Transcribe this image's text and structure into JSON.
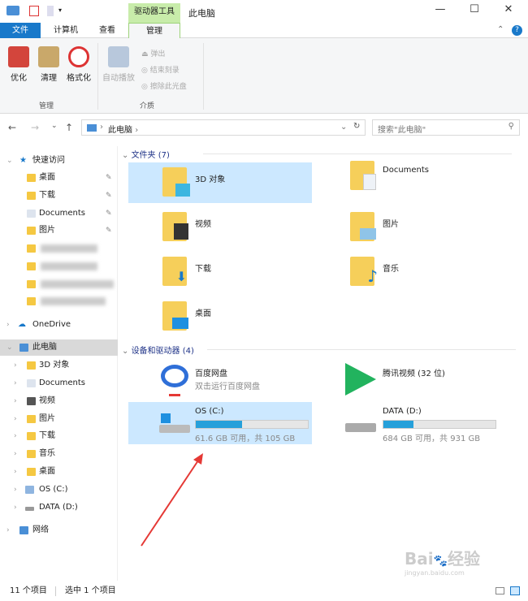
{
  "window": {
    "title": "此电脑",
    "context_tab_header": "驱动器工具",
    "controls": [
      "minimize",
      "maximize",
      "close"
    ]
  },
  "tabs": [
    {
      "label": "文件"
    },
    {
      "label": "计算机"
    },
    {
      "label": "查看"
    },
    {
      "label": "管理"
    }
  ],
  "ribbon": {
    "buttons": [
      {
        "label": "优化",
        "icon": "optimize-icon"
      },
      {
        "label": "清理",
        "icon": "cleanup-icon"
      },
      {
        "label": "格式化",
        "icon": "format-icon"
      },
      {
        "label": "自动播放",
        "icon": "autoplay-icon"
      }
    ],
    "small_buttons": [
      {
        "label": "弹出"
      },
      {
        "label": "结束刻录"
      },
      {
        "label": "擦除此光盘"
      }
    ],
    "groups": [
      "管理",
      "介质"
    ]
  },
  "address": {
    "path": "此电脑",
    "search_placeholder": "搜索\"此电脑\""
  },
  "nav": {
    "quick_access": "快速访问",
    "quick_items": [
      "桌面",
      "下载",
      "Documents",
      "图片"
    ],
    "onedrive": "OneDrive",
    "this_pc": "此电脑",
    "pc_items": [
      "3D 对象",
      "Documents",
      "视频",
      "图片",
      "下载",
      "音乐",
      "桌面",
      "OS (C:)",
      "DATA (D:)"
    ],
    "network": "网络"
  },
  "folders": {
    "header": "文件夹 (7)",
    "items": [
      "3D 对象",
      "Documents",
      "视频",
      "图片",
      "下载",
      "音乐",
      "桌面"
    ]
  },
  "devices": {
    "header": "设备和驱动器 (4)",
    "items": [
      {
        "name": "百度网盘",
        "sub": "双击运行百度网盘"
      },
      {
        "name": "腾讯视频 (32 位)",
        "sub": ""
      },
      {
        "name": "OS (C:)",
        "sub": "61.6 GB 可用，共 105 GB",
        "used_fraction": 0.41
      },
      {
        "name": "DATA (D:)",
        "sub": "684 GB 可用，共 931 GB",
        "used_fraction": 0.27
      }
    ]
  },
  "status": {
    "count": "11 个项目",
    "selected": "选中 1 个项目"
  },
  "watermark": "Baidu 经验 jingyan.baidu.com",
  "colors": {
    "accent": "#1979ca",
    "selection": "#cce8ff",
    "context_tab": "#c8ecaa",
    "bar": "#26a0da",
    "arrow": "#e53935"
  }
}
